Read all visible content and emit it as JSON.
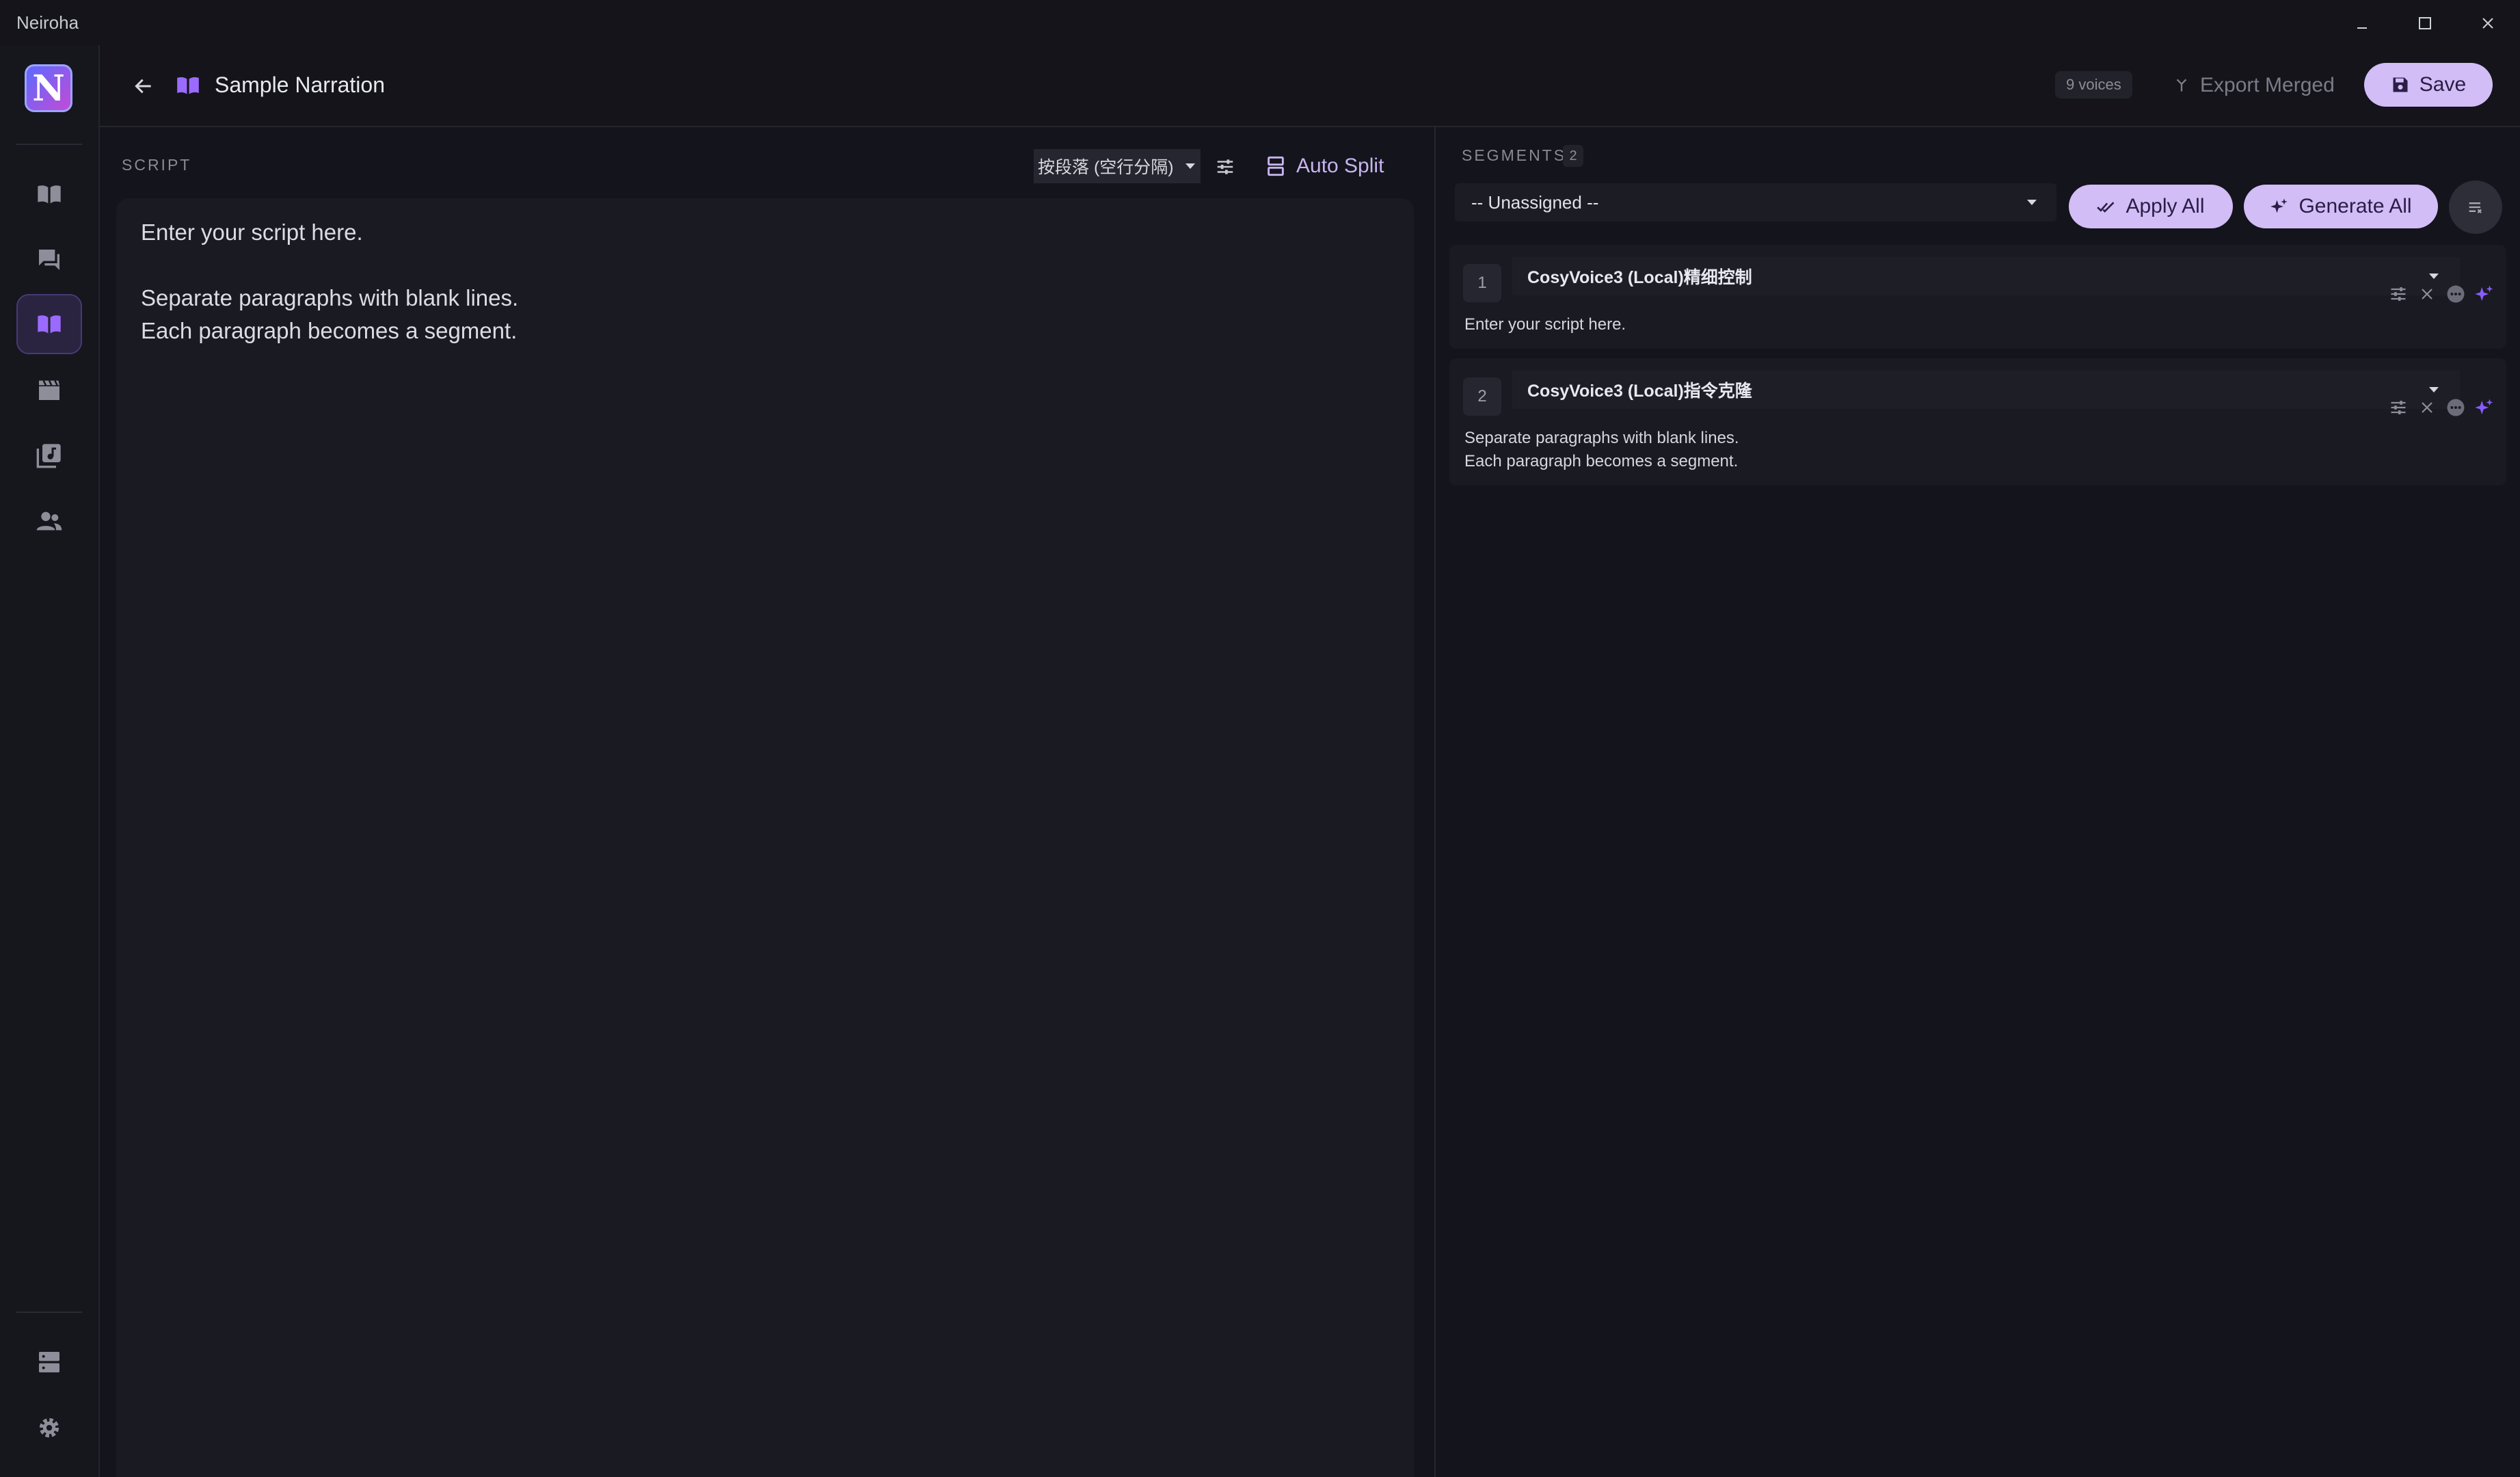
{
  "app": {
    "title": "Neiroha",
    "logo_letter": "N"
  },
  "header": {
    "title": "Sample Narration",
    "voices_badge": "9 voices",
    "export_label": "Export Merged",
    "save_label": "Save"
  },
  "script": {
    "section_label": "SCRIPT",
    "split_mode": "按段落 (空行分隔)",
    "auto_split_label": "Auto Split",
    "text": "Enter your script here.\n\nSeparate paragraphs with blank lines.\nEach paragraph becomes a segment."
  },
  "segments": {
    "section_label": "SEGMENTS",
    "count": "2",
    "voice_select": "-- Unassigned --",
    "apply_all_label": "Apply All",
    "generate_all_label": "Generate All",
    "items": [
      {
        "index": "1",
        "voice": "CosyVoice3 (Local)精细控制",
        "text": "Enter your script here."
      },
      {
        "index": "2",
        "voice": "CosyVoice3 (Local)指令克隆",
        "text": "Separate paragraphs with blank lines.\nEach paragraph becomes a segment."
      }
    ]
  },
  "colors": {
    "accent": "#d2bdf6",
    "accent_text": "#c7b4f0",
    "sparkle": "#8a5cff",
    "background": "#14141c"
  }
}
